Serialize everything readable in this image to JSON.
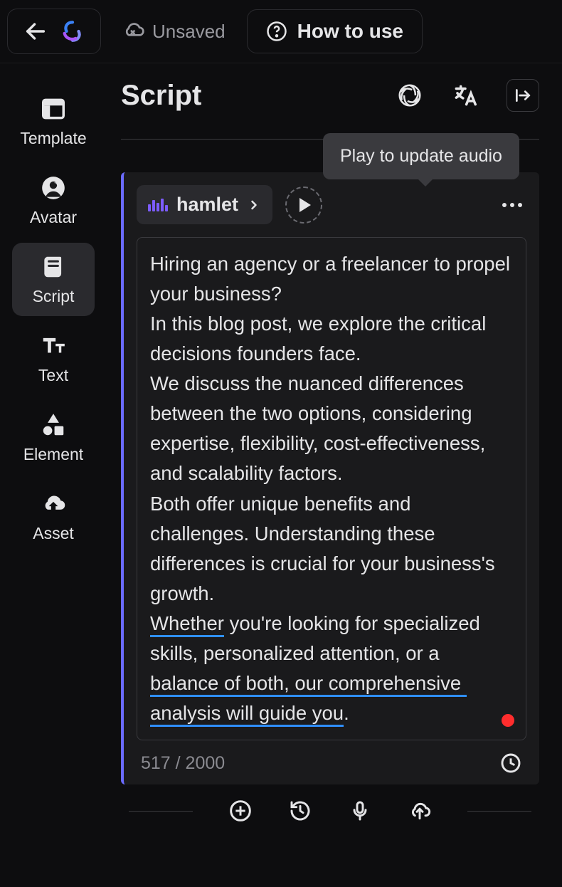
{
  "topbar": {
    "unsaved_label": "Unsaved",
    "howto_label": "How to use"
  },
  "sidebar": {
    "items": [
      {
        "label": "Template"
      },
      {
        "label": "Avatar"
      },
      {
        "label": "Script"
      },
      {
        "label": "Text"
      },
      {
        "label": "Element"
      },
      {
        "label": "Asset"
      }
    ]
  },
  "header": {
    "title": "Script"
  },
  "tooltip": {
    "text": "Play to update audio"
  },
  "voice": {
    "name": "hamlet"
  },
  "script": {
    "p1": "Hiring an agency or a freelancer to propel your business?",
    "p2": "In this blog post, we explore the critical decisions founders face.",
    "p3": "We discuss the nuanced differences between the two options, considering expertise, flexibility, cost-effectiveness, and scalability factors.",
    "p4": "Both offer unique benefits and challenges. Understanding these differences is crucial for your business's growth.",
    "p5_a": "Whether",
    "p5_b": " you're looking for specialized skills, personalized attention, or a ",
    "p5_c": "balance of both, our comprehensive analysis will guide you",
    "p5_d": "."
  },
  "counter": {
    "text": "517 / 2000"
  }
}
